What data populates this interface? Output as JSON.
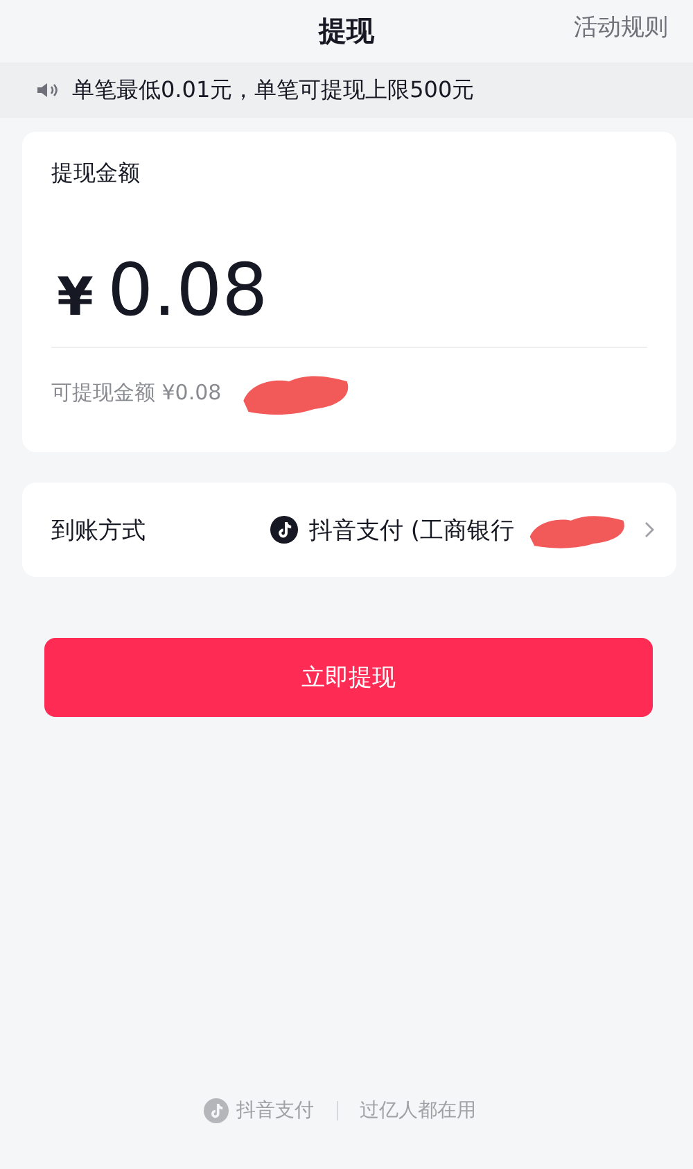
{
  "header": {
    "title": "提现",
    "rules_link": "活动规则"
  },
  "notice": {
    "text": "单笔最低0.01元，单笔可提现上限500元"
  },
  "amount_card": {
    "label": "提现金额",
    "currency": "¥",
    "amount": "0.08",
    "available": "可提现金额 ¥0.08"
  },
  "payout": {
    "label": "到账方式",
    "method": "抖音支付 (工商银行"
  },
  "submit_button": "立即提现",
  "footer": {
    "brand": "抖音支付",
    "slogan": "过亿人都在用"
  }
}
